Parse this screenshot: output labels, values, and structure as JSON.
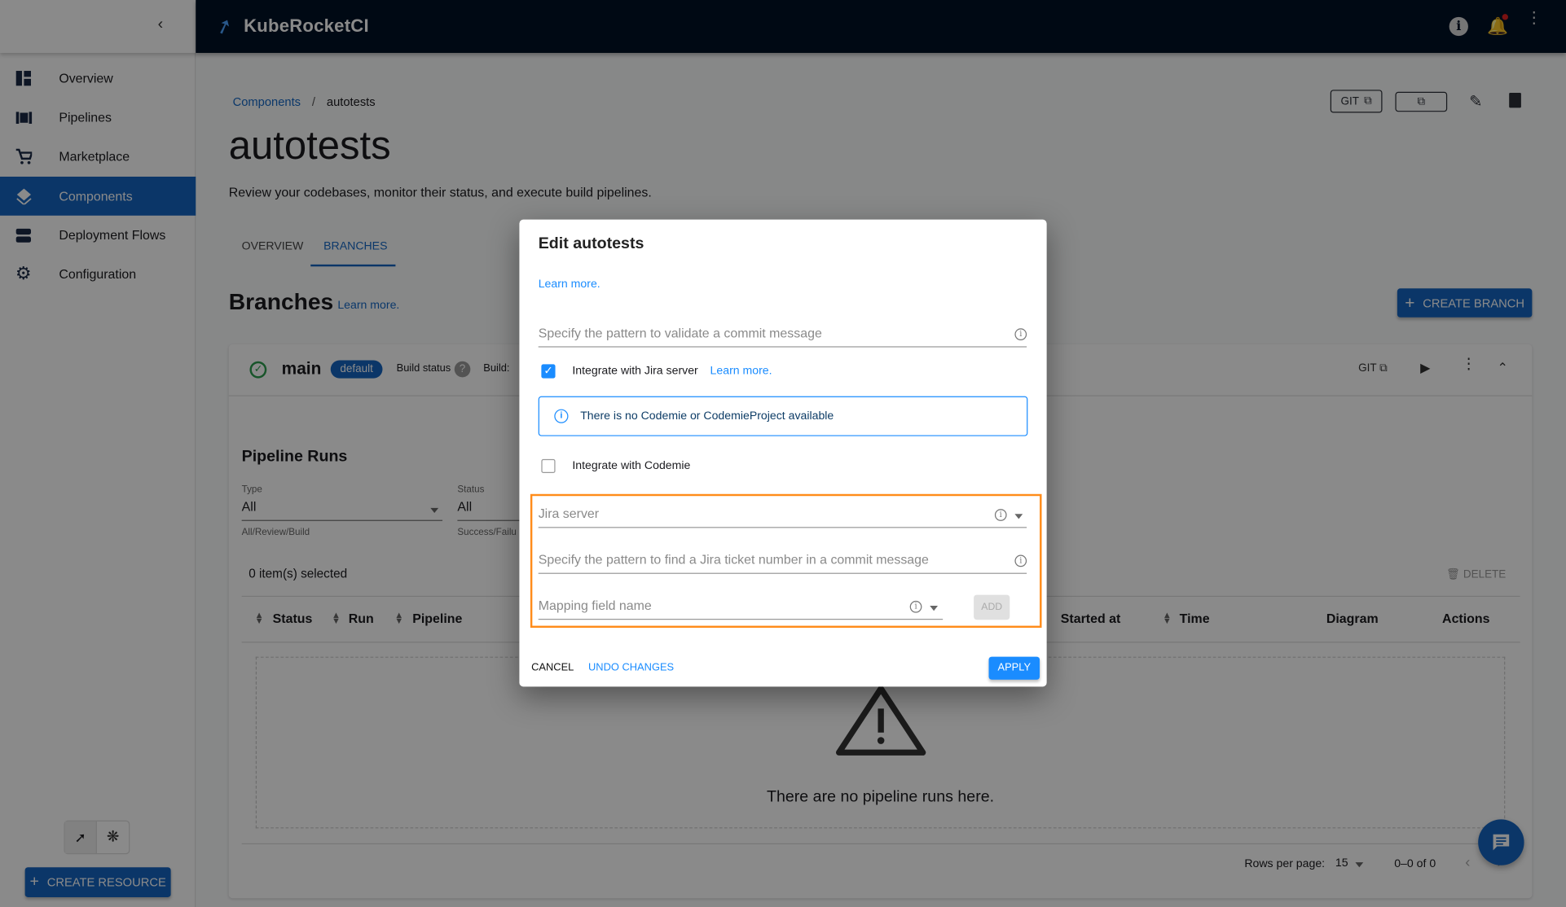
{
  "app": {
    "name": "KubeRocketCI"
  },
  "sidebar": {
    "items": [
      {
        "label": "Overview",
        "icon": "dashboard-icon"
      },
      {
        "label": "Pipelines",
        "icon": "pipelines-icon"
      },
      {
        "label": "Marketplace",
        "icon": "cart-icon"
      },
      {
        "label": "Components",
        "icon": "layers-icon",
        "active": true
      },
      {
        "label": "Deployment Flows",
        "icon": "deployment-icon"
      },
      {
        "label": "Configuration",
        "icon": "gear-icon"
      }
    ],
    "create_resource": "CREATE RESOURCE"
  },
  "breadcrumb": {
    "parent": "Components",
    "sep": "/",
    "current": "autotests"
  },
  "page": {
    "title": "autotests",
    "description": "Review your codebases, monitor their status, and execute build pipelines.",
    "git_button": "GIT",
    "tabs": [
      {
        "label": "OVERVIEW"
      },
      {
        "label": "BRANCHES",
        "active": true
      }
    ]
  },
  "branches": {
    "title": "Branches",
    "learn_more": "Learn more.",
    "create_button": "CREATE BRANCH",
    "branch": {
      "name": "main",
      "badge": "default",
      "build_status": "Build status",
      "build": "Build:",
      "git": "GIT"
    }
  },
  "pipeline_runs": {
    "title": "Pipeline Runs",
    "type_filter": {
      "label": "Type",
      "value": "All",
      "helper": "All/Review/Build"
    },
    "status_filter": {
      "label": "Status",
      "value": "All",
      "helper": "Success/Failu"
    },
    "selected": "0 item(s) selected",
    "delete": "DELETE",
    "columns": [
      "Status",
      "Run",
      "Pipeline",
      "Started at",
      "Time",
      "Diagram",
      "Actions"
    ],
    "empty": "There are no pipeline runs here.",
    "rows_per_page_label": "Rows per page:",
    "rows_per_page": "15",
    "range": "0–0 of 0"
  },
  "modal": {
    "title": "Edit autotests",
    "learn_more": "Learn more.",
    "commit_pattern_placeholder": "Specify the pattern to validate a commit message",
    "jira_checkbox": {
      "label": "Integrate with Jira server",
      "checked": true,
      "learn_more": "Learn more."
    },
    "alert": "There is no Codemie or CodemieProject available",
    "codemie_checkbox": {
      "label": "Integrate with Codemie",
      "checked": false
    },
    "jira_server_placeholder": "Jira server",
    "jira_pattern_placeholder": "Specify the pattern to find a Jira ticket number in a commit message",
    "mapping_placeholder": "Mapping field name",
    "add": "ADD",
    "cancel": "CANCEL",
    "undo": "UNDO CHANGES",
    "apply": "APPLY",
    "highlight_color": "#ff8c1a",
    "accent": "#1a8cff"
  }
}
